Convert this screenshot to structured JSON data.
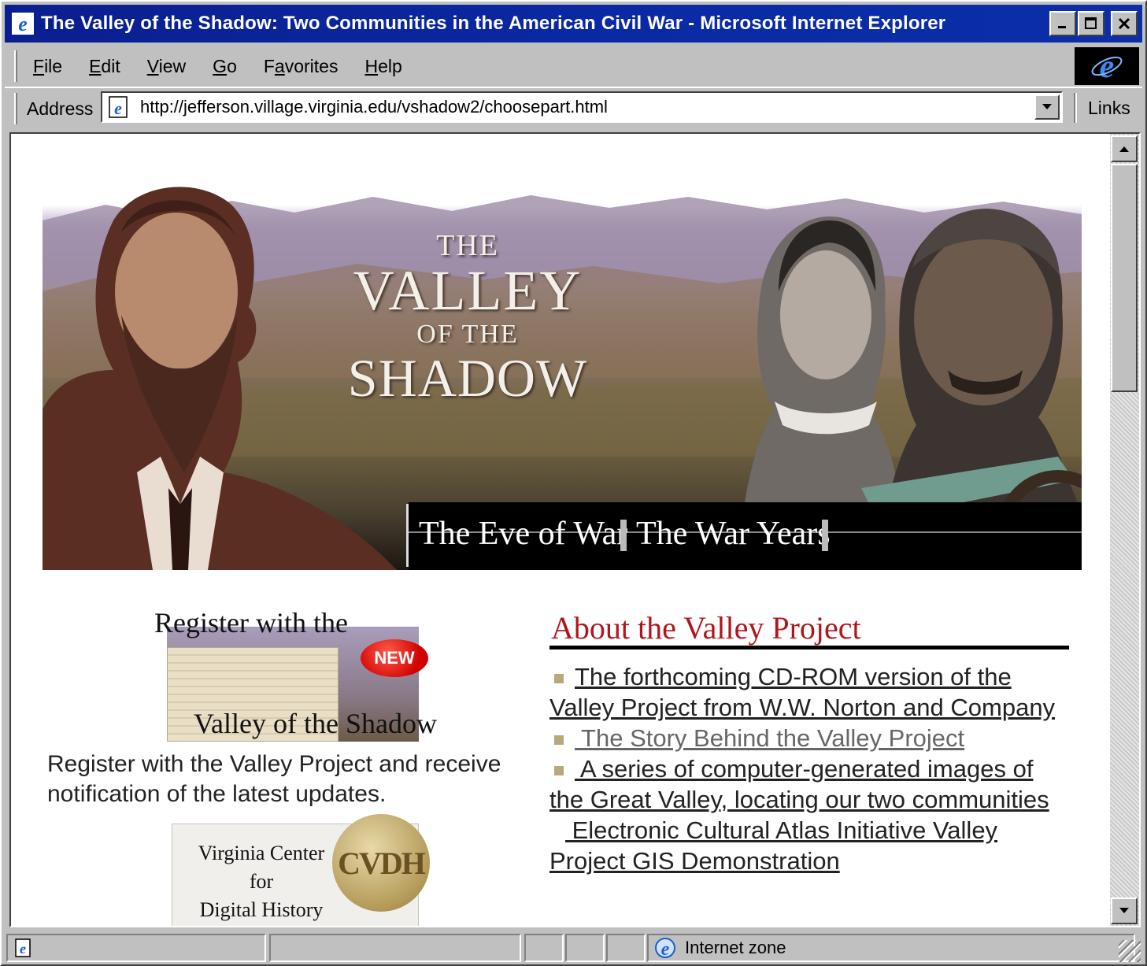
{
  "window": {
    "title": "The Valley of the Shadow: Two Communities in the American Civil War - Microsoft Internet Explorer",
    "buttons": {
      "minimize": "_",
      "maximize": "□",
      "close": "✕"
    }
  },
  "menubar": {
    "items": [
      {
        "label": "File",
        "accel": "F",
        "rest": "ile"
      },
      {
        "label": "Edit",
        "accel": "E",
        "rest": "dit"
      },
      {
        "label": "View",
        "accel": "V",
        "rest": "iew"
      },
      {
        "label": "Go",
        "accel": "G",
        "rest": "o"
      },
      {
        "label": "Favorites",
        "pre": "F",
        "accel": "a",
        "rest": "vorites"
      },
      {
        "label": "Help",
        "accel": "H",
        "rest": "elp"
      }
    ]
  },
  "addressbar": {
    "label": "Address",
    "url": "http://jefferson.village.virginia.edu/vshadow2/choosepart.html",
    "links_label": "Links"
  },
  "banner": {
    "title_line1": "THE",
    "title_line2": "VALLEY",
    "title_line3": "OF THE",
    "title_line4": "SHADOW",
    "nav": [
      {
        "label": "The Eve of War"
      },
      {
        "label": "The War Years"
      }
    ]
  },
  "register": {
    "heading": "Register with the",
    "image_subtitle": "Valley of the Shadow",
    "badge": "NEW",
    "text": "Register with the Valley Project and receive notification of the latest updates."
  },
  "vcdh": {
    "line1": "Virginia Center",
    "line2": "for",
    "line3": "Digital History",
    "seal": "CVDH"
  },
  "about": {
    "heading": "About the Valley Project",
    "items": [
      {
        "text": "The forthcoming CD-ROM version of the Valley Project from W.W. Norton and Company",
        "bullet": true,
        "visited": false
      },
      {
        "text": " The Story Behind the Valley Project",
        "bullet": true,
        "visited": true
      },
      {
        "text": " A series of computer-generated images of the Great Valley, locating our two communities",
        "bullet": true,
        "visited": false
      },
      {
        "text": " Electronic Cultural Atlas Initiative Valley Project GIS Demonstration",
        "bullet": false,
        "visited": false
      }
    ]
  },
  "statusbar": {
    "zone": "Internet zone"
  },
  "colors": {
    "titlebar": "#0a2aa6",
    "about_heading": "#b0151c",
    "new_badge": "#d00000"
  }
}
